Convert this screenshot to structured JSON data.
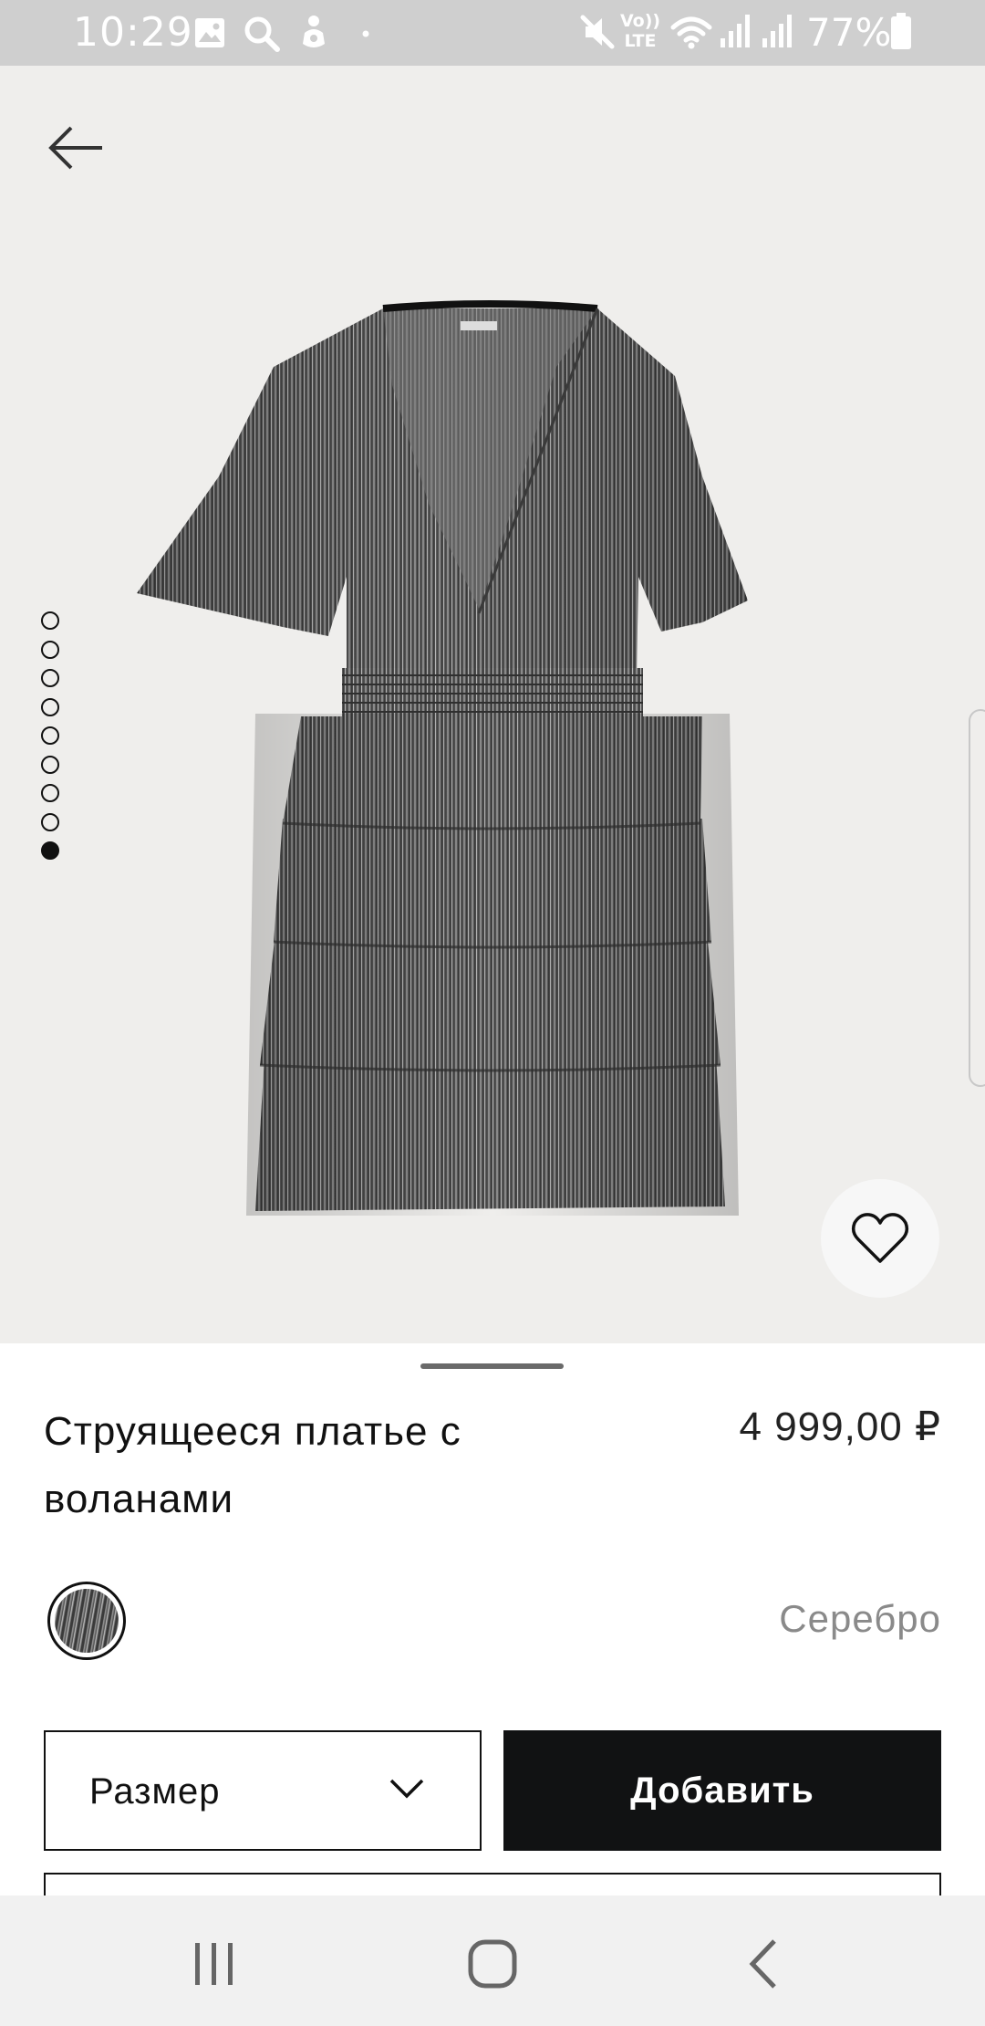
{
  "status_bar": {
    "time": "10:29",
    "battery_percent": "77%",
    "icons": [
      "gallery-icon",
      "search-icon",
      "bixby-icon",
      "dot-icon",
      "mute-icon",
      "volte-icon",
      "wifi-icon",
      "signal-icon",
      "signal-icon",
      "battery-icon"
    ],
    "volte_text": "Vo)) LTE"
  },
  "product": {
    "image": {
      "pager_total": 9,
      "pager_active_index": 8
    },
    "title": "Струящееся платье с воланами",
    "price": "4 999,00 ₽",
    "color": {
      "name": "Серебро",
      "swatch": "silver-lurex"
    },
    "size_select": {
      "label": "Размер"
    },
    "add_button_label": "Добавить"
  },
  "icons": {
    "back": "arrow-left-icon",
    "wishlist": "heart-icon",
    "size_dropdown": "chevron-down-icon"
  },
  "nav_bar": {
    "items": [
      "recent-apps-icon",
      "home-icon",
      "back-icon"
    ]
  },
  "colors": {
    "primary_button": "#111213",
    "status_bar": "#cfcfcf",
    "image_background": "#efeeec",
    "color_name_text": "#8a8a8a"
  }
}
